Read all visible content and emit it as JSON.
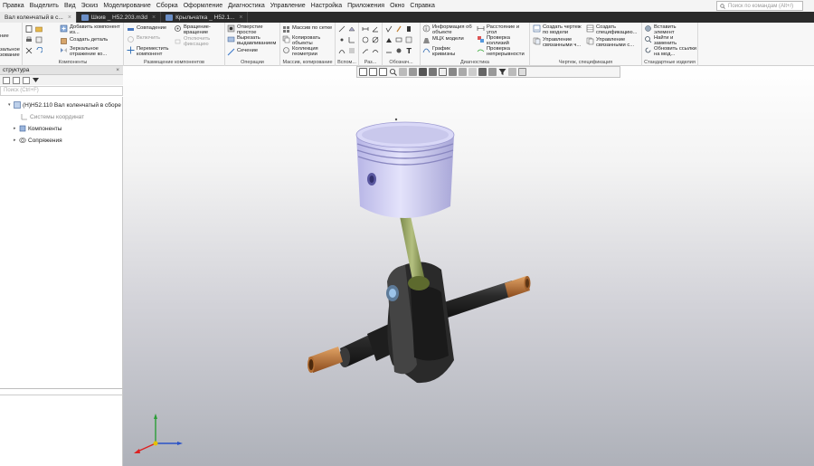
{
  "menu": [
    "Правка",
    "Выделить",
    "Вид",
    "Эскиз",
    "Моделирование",
    "Сборка",
    "Оформление",
    "Диагностика",
    "Управление",
    "Настройка",
    "Приложения",
    "Окно",
    "Справка"
  ],
  "command_search_placeholder": "Поиск по командам (Alt+/)",
  "tabs": [
    {
      "label": "Вал коленчатый в с...",
      "active": true
    },
    {
      "label": "Шкив _ Н52.203.m3d",
      "active": false
    },
    {
      "label": "Крыльчатка _ Н52.1...",
      "active": false
    }
  ],
  "ribbon": {
    "left_cut": {
      "line1": "ние",
      "line2": "зальное",
      "line3": "зование",
      "label": "Системная"
    },
    "components": {
      "add": "Добавить компонент из...",
      "create": "Создать деталь",
      "mirror": "Зеркальное отражение ко...",
      "label": "Компоненты"
    },
    "placement": {
      "coincide": "Совпадение",
      "rotate": "Вращение-вращение",
      "turn_on": "Включить",
      "turn_off": "Отключить",
      "fix": "фиксацию",
      "move": "Переместить компонент",
      "label": "Размещение компонентов"
    },
    "operations": {
      "hole": "Отверстие простое",
      "cut": "Вырезать выдавливанием",
      "section": "Сечение",
      "label": "Операции"
    },
    "array": {
      "array": "Массив по сетке",
      "copy": "Копировать объекты",
      "collection": "Коллекция геометрии",
      "label": "Массив, копирование"
    },
    "aux": {
      "label": "Вспом..."
    },
    "sizes": {
      "label": "Раз..."
    },
    "notation": {
      "label": "Обознач..."
    },
    "diagnostics": {
      "info": "Информация об объекте",
      "mass": "МЦХ модели",
      "graph": "График кривизны",
      "dist": "Расстояние и угол",
      "collisions": "Проверка коллизий",
      "continuity": "Проверка непрерывности",
      "label": "Диагностика"
    },
    "drawing": {
      "create_drawing": "Создать чертеж по модели",
      "manage_linked": "Управление связанными ч...",
      "create_spec": "Создать спецификацию...",
      "manage_spec": "Управление связанными с...",
      "label": "Чертеж, спецификация"
    },
    "standard": {
      "insert": "Вставить элемент",
      "find": "Найти и заменить",
      "update": "Обновить ссылки на мод...",
      "label": "Стандартные изделия"
    }
  },
  "panel": {
    "title": "структура",
    "search_placeholder": "Поиск (Ctrl+F)",
    "tree": [
      {
        "label": "(Н)Н52.110 Вал коленчатый в сборе (Те)",
        "level": 0,
        "dim": false
      },
      {
        "label": "Системы координат",
        "level": 1,
        "dim": true
      },
      {
        "label": "Компоненты",
        "level": 1,
        "dim": false
      },
      {
        "label": "Сопряжения",
        "level": 1,
        "dim": false
      }
    ]
  },
  "colors": {
    "tabbar": "#2b2b2b",
    "piston": "#c9c8ec",
    "rod": "#9aa66a",
    "crank": "#333333",
    "copper": "#c07a40",
    "bolt": "#7bb7e0"
  },
  "icons": [
    "search-icon",
    "close-icon",
    "filter-icon",
    "axis-triad-icon"
  ]
}
